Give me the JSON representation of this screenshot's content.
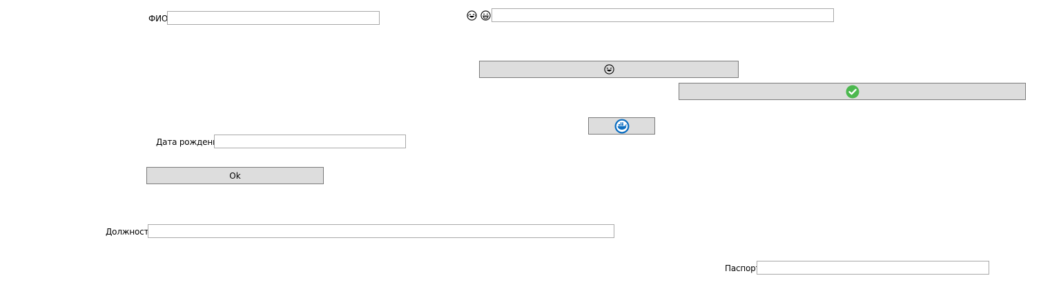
{
  "form": {
    "fio_label": "ФИО",
    "fio_value": "",
    "birth_date_label": "Дата рождения",
    "birth_date_value": "",
    "position_label": "Должность",
    "position_value": "",
    "passport_label": "Паспорт",
    "passport_value": "",
    "emoji_field_value": ""
  },
  "buttons": {
    "ok_label": "Ok"
  },
  "icons": {
    "emoji_label_icon_1": "laughing-face-icon",
    "emoji_label_icon_2": "grinning-face-icon",
    "emoji_button_icon": "laughing-face-icon",
    "confirm_button_icon": "check-circle-icon",
    "docker_button_icon": "docker-whale-icon"
  },
  "colors": {
    "check_green": "#4cb84f",
    "docker_blue": "#0d6fc2",
    "button_bg": "#dddddd"
  }
}
